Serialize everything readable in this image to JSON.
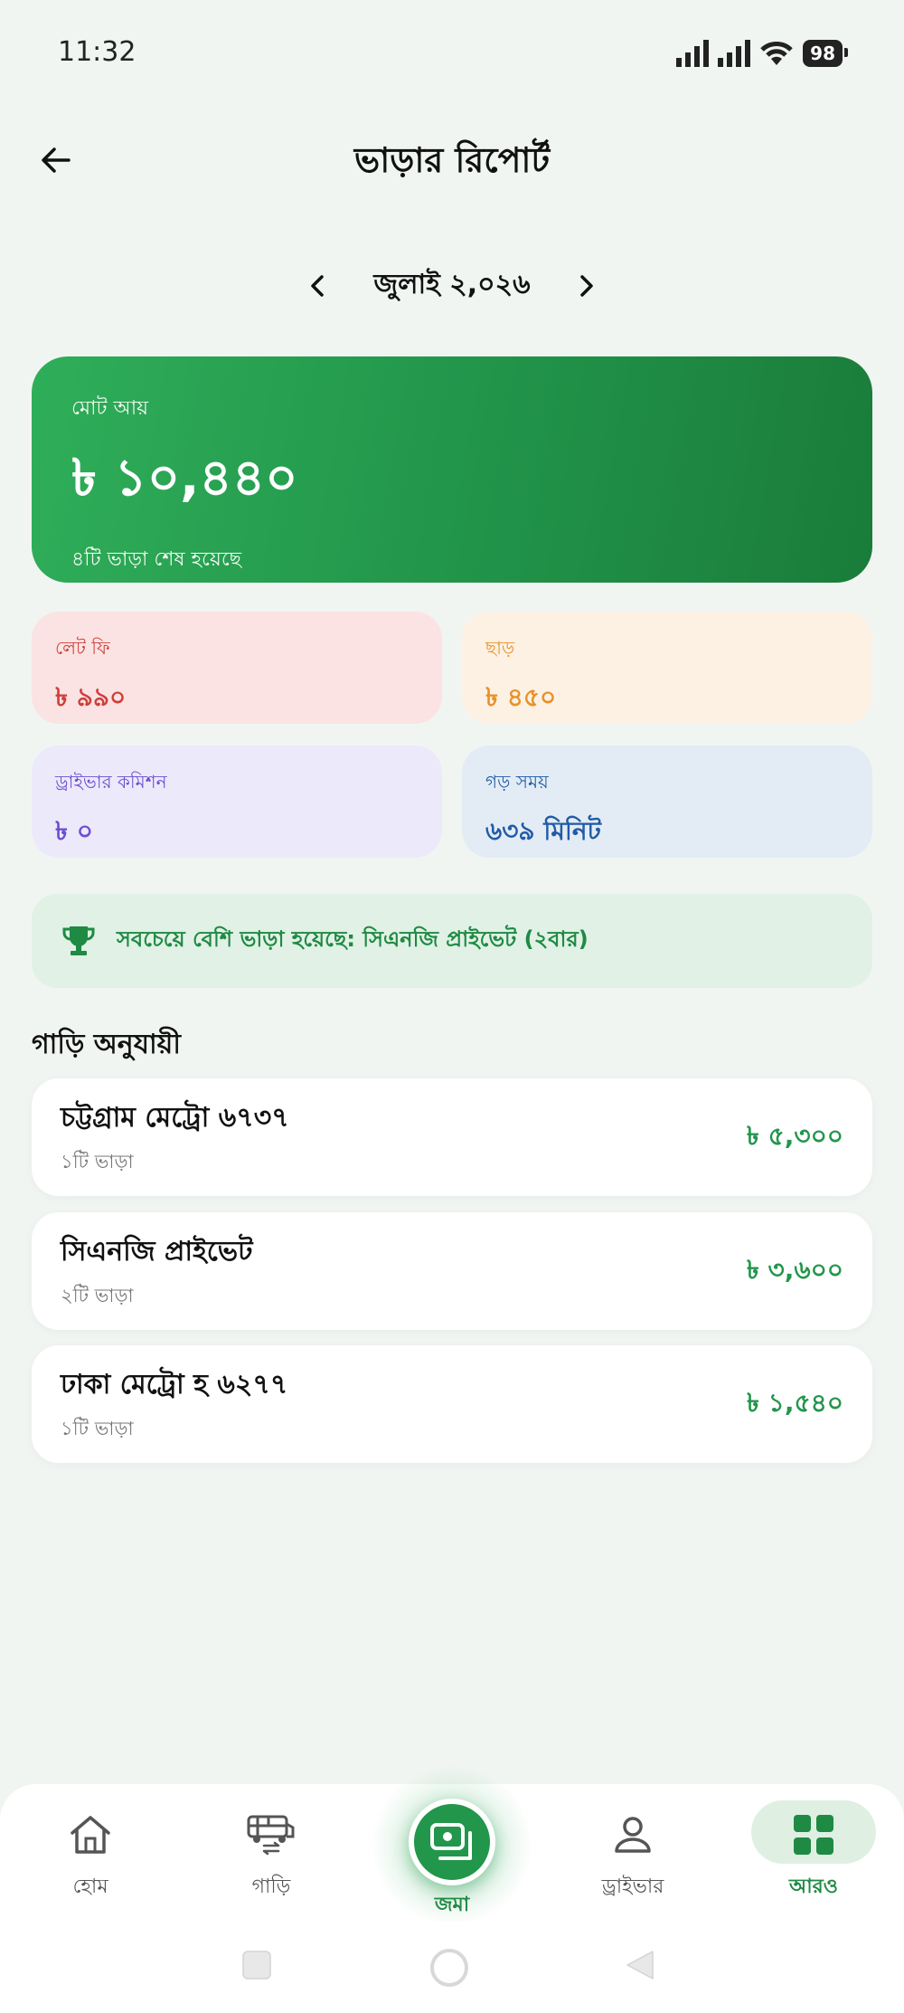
{
  "status_bar": {
    "time": "11:32",
    "battery": "98"
  },
  "header": {
    "title": "ভাড়ার রিপোর্ট"
  },
  "month_selector": {
    "label": "জুলাই ২,০২৬"
  },
  "summary": {
    "label": "মোট আয়",
    "amount": "৳ ১০,৪৪০",
    "subtitle": "৪টি ভাড়া শেষ হয়েছে"
  },
  "stats": {
    "late_fee": {
      "label": "লেট ফি",
      "value": "৳ ৯৯০"
    },
    "discount": {
      "label": "ছাড়",
      "value": "৳ ৪৫০"
    },
    "commission": {
      "label": "ড্রাইভার কমিশন",
      "value": "৳ ০"
    },
    "avg_time": {
      "label": "গড় সময়",
      "value": "৬৩৯ মিনিট"
    }
  },
  "top_rented": {
    "text": "সবচেয়ে বেশি ভাড়া হয়েছে: সিএনজি প্রাইভেট (২বার)"
  },
  "section": {
    "title": "গাড়ি অনুযায়ী"
  },
  "cars": [
    {
      "name": "চট্টগ্রাম মেট্রো ৬৭৩৭",
      "trips": "১টি ভাড়া",
      "amount": "৳ ৫,৩০০"
    },
    {
      "name": "সিএনজি প্রাইভেট",
      "trips": "২টি ভাড়া",
      "amount": "৳ ৩,৬০০"
    },
    {
      "name": "ঢাকা মেট্রো হ ৬২৭৭",
      "trips": "১টি ভাড়া",
      "amount": "৳ ১,৫৪০"
    }
  ],
  "bottom_nav": {
    "home": "হোম",
    "cars": "গাড়ি",
    "deposit": "জমা",
    "driver": "ড্রাইভার",
    "more": "আরও"
  },
  "colors": {
    "primary": "#22964b",
    "background": "#f1f5f2"
  }
}
